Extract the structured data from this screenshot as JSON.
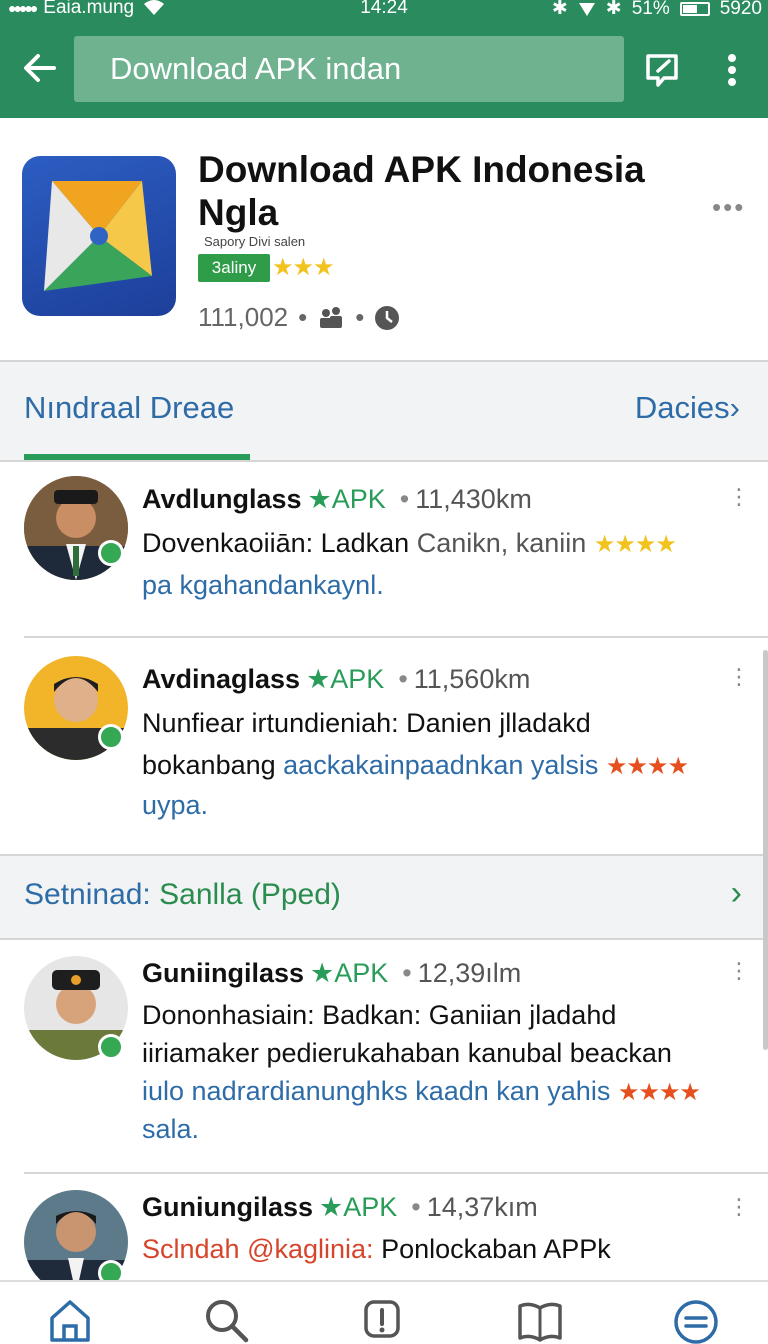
{
  "status_bar": {
    "carrier": "Eaia.mung",
    "time": "14:24",
    "battery": "51%",
    "right_value": "5920",
    "status_icons": [
      "bluetooth-icon",
      "signal-icon",
      "battery-icon"
    ]
  },
  "toolbar": {
    "search_value": "Download APK indan",
    "icons": [
      "back-arrow-icon",
      "edit-icon",
      "more-vert-icon"
    ]
  },
  "app": {
    "title": "Download APK Indonesia Ngla",
    "developer": "Sapory Divi salen",
    "badge": "3aliny",
    "stars": "★★★",
    "count": "111,002",
    "dot1": "•",
    "dot2": "•",
    "more": "•••"
  },
  "section1": {
    "title": "Nındraal  Dreae",
    "link": "Dacies"
  },
  "section2": {
    "title_blue": "Setninad:",
    "title_green": "Sanlla (Pped)"
  },
  "apk_label": "APK",
  "sep": "•",
  "items": [
    {
      "name": "Avdlunglass",
      "distance": "11,430km",
      "line1": "Dovenkaoiiān: Ladkan",
      "line1_gray": "Canikn, kaniin",
      "stars": "★★★★",
      "line2": "pa kgahandankaynl."
    },
    {
      "name": "Avdinaglass",
      "distance": "11,560km",
      "line1": "Nunfiear irtundieniah: Danien jlladakd",
      "line2_black": "bokanbang",
      "line2_blue": "aackakainpaadnkan yalsis",
      "stars": "★★★★",
      "line3": "uypa."
    },
    {
      "name": "Guniingilass",
      "distance": "12,39ılm",
      "line1": "Dononhasiain: Badkan: Ganiian jladahd",
      "line2": "iiriamaker pedierukahaban kanubal beackan",
      "line3": "iulo nadrardianunghks kaadn kan yahis",
      "stars": "★★★★",
      "line4": "sala."
    },
    {
      "name": "Guniungilass",
      "distance": "14,37kım",
      "line1_red": "Sclndah @kaglinia:",
      "line1": "Ponlockaban APPk"
    }
  ],
  "bottom_nav": [
    "home-icon",
    "search-icon",
    "alert-icon",
    "book-icon",
    "menu-icon"
  ],
  "colors": {
    "primary": "#2a8c5e",
    "link_blue": "#2e6ca8",
    "accent_green": "#2a9c5a",
    "star_yellow": "#f2c21d",
    "star_red": "#e6501f"
  }
}
